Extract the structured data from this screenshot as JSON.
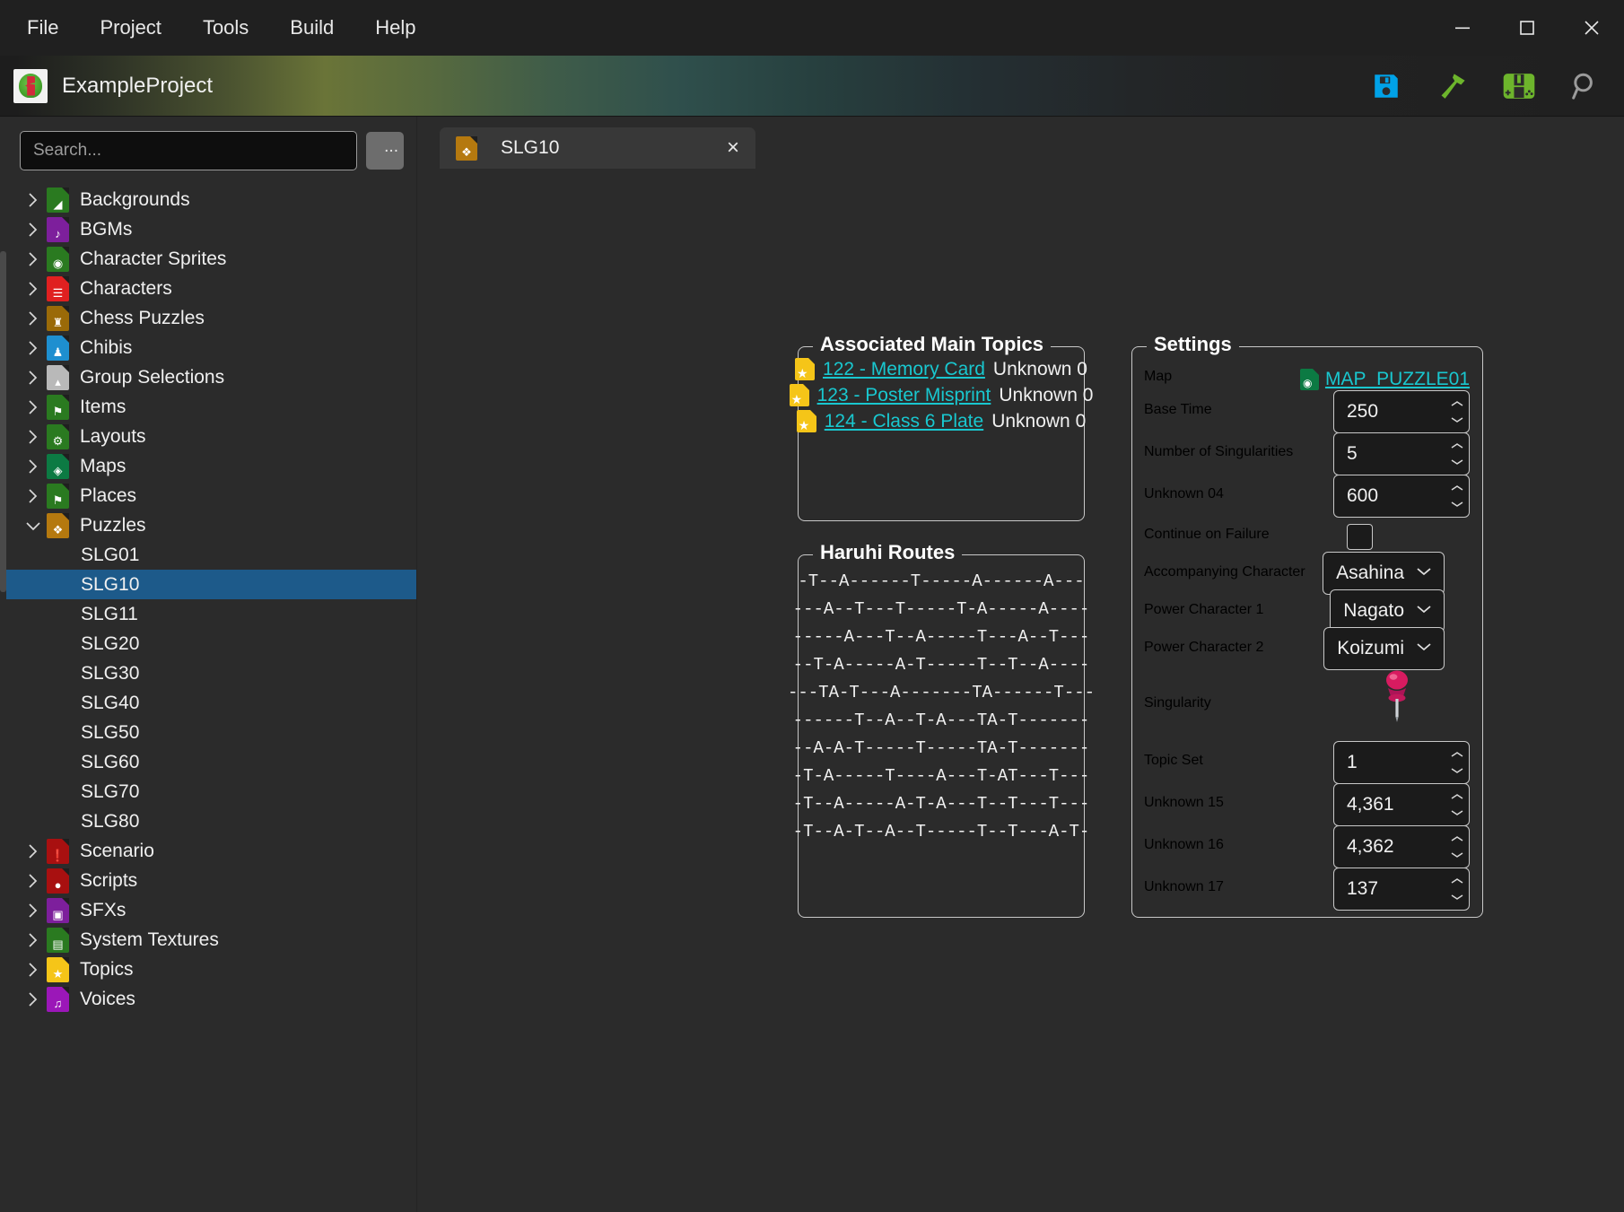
{
  "window": {
    "menu": [
      "File",
      "Project",
      "Tools",
      "Build",
      "Help"
    ],
    "controls": {
      "minimize": "minimize-icon",
      "maximize": "maximize-icon",
      "close": "close-icon"
    }
  },
  "project_header": {
    "name": "ExampleProject",
    "toolbar": [
      {
        "name": "save-icon",
        "color": "#00a2e8"
      },
      {
        "name": "build-hammer-icon",
        "color": "#6db52c"
      },
      {
        "name": "run-3ds-icon",
        "color": "#6db52c"
      },
      {
        "name": "search-icon",
        "color": "#9b9b9b"
      }
    ]
  },
  "sidebar": {
    "search": {
      "placeholder": "Search...",
      "value": ""
    },
    "more_button": "...",
    "tree": [
      {
        "label": "Backgrounds",
        "expanded": false,
        "icon": "#2a7a20",
        "glyph": "◢"
      },
      {
        "label": "BGMs",
        "expanded": false,
        "icon": "#7d1f9c",
        "glyph": "♪"
      },
      {
        "label": "Character Sprites",
        "expanded": false,
        "icon": "#2a7a20",
        "glyph": "◉"
      },
      {
        "label": "Characters",
        "expanded": false,
        "icon": "#e02020",
        "glyph": "☰"
      },
      {
        "label": "Chess Puzzles",
        "expanded": false,
        "icon": "#9a6a08",
        "glyph": "♜"
      },
      {
        "label": "Chibis",
        "expanded": false,
        "icon": "#1e8fd0",
        "glyph": "♟"
      },
      {
        "label": "Group Selections",
        "expanded": false,
        "icon": "#b9b9b9",
        "glyph": "▴"
      },
      {
        "label": "Items",
        "expanded": false,
        "icon": "#2a7a20",
        "glyph": "⚑"
      },
      {
        "label": "Layouts",
        "expanded": false,
        "icon": "#2a7a20",
        "glyph": "⚙"
      },
      {
        "label": "Maps",
        "expanded": false,
        "icon": "#0c7a43",
        "glyph": "◈"
      },
      {
        "label": "Places",
        "expanded": false,
        "icon": "#2a7a20",
        "glyph": "⚑"
      },
      {
        "label": "Puzzles",
        "expanded": true,
        "icon": "#b5790f",
        "glyph": "❖"
      }
    ],
    "puzzle_children": [
      "SLG01",
      "SLG10",
      "SLG11",
      "SLG20",
      "SLG30",
      "SLG40",
      "SLG50",
      "SLG60",
      "SLG70",
      "SLG80"
    ],
    "selected_child": "SLG10",
    "tree_after": [
      {
        "label": "Scenario",
        "expanded": false,
        "icon": "#a81010",
        "glyph": "❗"
      },
      {
        "label": "Scripts",
        "expanded": false,
        "icon": "#a81010",
        "glyph": "●"
      },
      {
        "label": "SFXs",
        "expanded": false,
        "icon": "#7d1f9c",
        "glyph": "▣"
      },
      {
        "label": "System Textures",
        "expanded": false,
        "icon": "#2a7a20",
        "glyph": "▤"
      },
      {
        "label": "Topics",
        "expanded": false,
        "icon": "#f5c518",
        "glyph": "★"
      },
      {
        "label": "Voices",
        "expanded": false,
        "icon": "#9b17b8",
        "glyph": "♫"
      }
    ]
  },
  "tab": {
    "title": "SLG10",
    "close": "×",
    "icon": "puzzle-document-icon"
  },
  "associated_main_topics": {
    "title": "Associated Main Topics",
    "items": [
      {
        "link": "122 - Memory Card",
        "unknown": "Unknown 0"
      },
      {
        "link": "123 - Poster Misprint",
        "unknown": "Unknown 0"
      },
      {
        "link": "124 - Class 6 Plate",
        "unknown": "Unknown 0"
      }
    ]
  },
  "haruhi_routes": {
    "title": "Haruhi Routes",
    "lines": [
      "-T--A------T-----A------A---",
      "---A--T---T-----T-A-----A----",
      "-----A---T--A-----T---A--T---",
      "--T-A-----A-T-----T--T--A----",
      "---TA-T---A-------TA------T---",
      "------T--A--T-A---TA-T-------",
      "--A-A-T-----T-----TA-T-------",
      "-T-A-----T----A---T-AT---T---",
      "-T--A-----A-T-A---T--T---T---",
      "-T--A-T--A--T-----T--T---A-T-"
    ]
  },
  "settings": {
    "title": "Settings",
    "map": {
      "label": "Map",
      "value": "MAP_PUZZLE01"
    },
    "base_time": {
      "label": "Base Time",
      "value": "250"
    },
    "num_singularities": {
      "label": "Number of Singularities",
      "value": "5"
    },
    "unknown_04": {
      "label": "Unknown 04",
      "value": "600"
    },
    "continue_on_failure": {
      "label": "Continue on Failure",
      "checked": false
    },
    "accompanying_character": {
      "label": "Accompanying Character",
      "value": "Asahina"
    },
    "power_character_1": {
      "label": "Power Character 1",
      "value": "Nagato"
    },
    "power_character_2": {
      "label": "Power Character 2",
      "value": "Koizumi"
    },
    "singularity": {
      "label": "Singularity",
      "icon": "pushpin-icon",
      "color": "#c2175b"
    },
    "topic_set": {
      "label": "Topic Set",
      "value": "1"
    },
    "unknown_15": {
      "label": "Unknown 15",
      "value": "4,361"
    },
    "unknown_16": {
      "label": "Unknown 16",
      "value": "4,362"
    },
    "unknown_17": {
      "label": "Unknown 17",
      "value": "137"
    }
  }
}
